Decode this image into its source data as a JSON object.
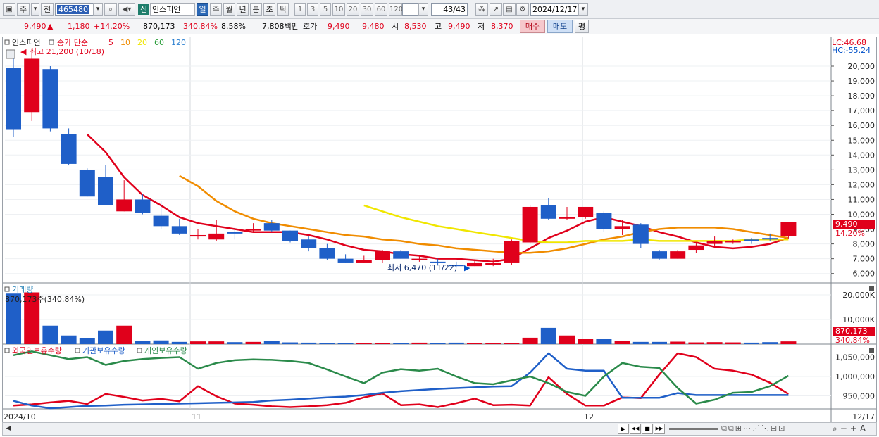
{
  "toolbar": {
    "market_label": "주",
    "prev_label": "전",
    "code": "465480",
    "name_tag": "신",
    "stock_name": "인스피언",
    "periods": [
      "일",
      "주",
      "월",
      "년",
      "분",
      "초",
      "틱"
    ],
    "active_period": "일",
    "intervals": [
      "1",
      "3",
      "5",
      "10",
      "20",
      "30",
      "60",
      "120"
    ],
    "count": "43",
    "count_total": "/43",
    "date": "2024/12/17"
  },
  "quote": {
    "price": "9,490",
    "arrow": "▲",
    "change": "1,180",
    "change_pct": "+14.20%",
    "volume": "870,173",
    "vol_ratio": "340.84%",
    "turnover": "8.58%",
    "amount": "7,808백만",
    "hoga_label": "호가",
    "ask": "9,490",
    "bid": "9,480",
    "open_label": "시",
    "open": "8,530",
    "high_label": "고",
    "high": "9,490",
    "low_label": "저",
    "low": "8,370",
    "buy_label": "매수",
    "sell_label": "매도",
    "avg_label": "평"
  },
  "chart_data": {
    "type": "candlestick",
    "title": "인스피언",
    "ma_label": "종가 단순",
    "ma_periods": [
      "5",
      "10",
      "20",
      "60",
      "120"
    ],
    "ma_colors": [
      "#e0001b",
      "#f08c00",
      "#f0e600",
      "#2a9d3a",
      "#2a7fd0"
    ],
    "high_note": "최고 21,200 (10/18)",
    "low_note": "최저 6,470 (11/22)",
    "lc_label": "LC:46.68",
    "hc_label": "HC:-55.24",
    "price_ticks": [
      "20,000",
      "19,000",
      "18,000",
      "17,000",
      "16,000",
      "15,000",
      "14,000",
      "13,000",
      "12,000",
      "11,000",
      "10,000",
      "9,000",
      "8,000",
      "7,000",
      "6,000"
    ],
    "last_price": "9,490",
    "last_pct": "14.20%",
    "x_labels": [
      "2024/10",
      "11",
      "12",
      "12/17"
    ],
    "up_color": "#e0001b",
    "down_color": "#1f5fc8",
    "candles": [
      {
        "o": 19900,
        "h": 20500,
        "l": 15200,
        "c": 15700
      },
      {
        "o": 16900,
        "h": 21200,
        "l": 16300,
        "c": 20500
      },
      {
        "o": 19800,
        "h": 20000,
        "l": 15600,
        "c": 15800
      },
      {
        "o": 15400,
        "h": 15800,
        "l": 13300,
        "c": 13400
      },
      {
        "o": 13000,
        "h": 13100,
        "l": 11200,
        "c": 11200
      },
      {
        "o": 12500,
        "h": 13300,
        "l": 10600,
        "c": 10600
      },
      {
        "o": 10200,
        "h": 12300,
        "l": 10200,
        "c": 11000
      },
      {
        "o": 11000,
        "h": 11400,
        "l": 10000,
        "c": 10100
      },
      {
        "o": 9900,
        "h": 10900,
        "l": 9000,
        "c": 9200
      },
      {
        "o": 9200,
        "h": 9700,
        "l": 8600,
        "c": 8700
      },
      {
        "o": 8500,
        "h": 9000,
        "l": 8300,
        "c": 8600
      },
      {
        "o": 8300,
        "h": 9600,
        "l": 8200,
        "c": 8700
      },
      {
        "o": 8800,
        "h": 9100,
        "l": 8300,
        "c": 8700
      },
      {
        "o": 8900,
        "h": 9400,
        "l": 8800,
        "c": 9000
      },
      {
        "o": 9400,
        "h": 9600,
        "l": 8800,
        "c": 8900
      },
      {
        "o": 8900,
        "h": 8900,
        "l": 8100,
        "c": 8200
      },
      {
        "o": 8300,
        "h": 8500,
        "l": 7500,
        "c": 7700
      },
      {
        "o": 7700,
        "h": 8000,
        "l": 6900,
        "c": 7000
      },
      {
        "o": 7000,
        "h": 7300,
        "l": 6700,
        "c": 6700
      },
      {
        "o": 6700,
        "h": 7200,
        "l": 6700,
        "c": 6900
      },
      {
        "o": 6900,
        "h": 7600,
        "l": 6700,
        "c": 7500
      },
      {
        "o": 7500,
        "h": 7600,
        "l": 7000,
        "c": 7000
      },
      {
        "o": 7000,
        "h": 7200,
        "l": 6800,
        "c": 7000
      },
      {
        "o": 6800,
        "h": 7000,
        "l": 6600,
        "c": 6700
      },
      {
        "o": 6600,
        "h": 6800,
        "l": 6470,
        "c": 6500
      },
      {
        "o": 6500,
        "h": 6900,
        "l": 6500,
        "c": 6700
      },
      {
        "o": 6600,
        "h": 7000,
        "l": 6500,
        "c": 6700
      },
      {
        "o": 6700,
        "h": 8300,
        "l": 6600,
        "c": 8200
      },
      {
        "o": 8100,
        "h": 10600,
        "l": 8000,
        "c": 10500
      },
      {
        "o": 10600,
        "h": 11100,
        "l": 9600,
        "c": 9700
      },
      {
        "o": 9700,
        "h": 10500,
        "l": 9600,
        "c": 9800
      },
      {
        "o": 9800,
        "h": 10500,
        "l": 9700,
        "c": 10500
      },
      {
        "o": 10100,
        "h": 10200,
        "l": 8800,
        "c": 9000
      },
      {
        "o": 9000,
        "h": 9600,
        "l": 8600,
        "c": 9200
      },
      {
        "o": 9300,
        "h": 9400,
        "l": 7700,
        "c": 8000
      },
      {
        "o": 7500,
        "h": 7600,
        "l": 6900,
        "c": 7000
      },
      {
        "o": 7000,
        "h": 7600,
        "l": 7000,
        "c": 7500
      },
      {
        "o": 7600,
        "h": 8100,
        "l": 7400,
        "c": 7900
      },
      {
        "o": 8000,
        "h": 8500,
        "l": 7800,
        "c": 8200
      },
      {
        "o": 8100,
        "h": 8300,
        "l": 8000,
        "c": 8200
      },
      {
        "o": 8300,
        "h": 8400,
        "l": 8000,
        "c": 8200
      },
      {
        "o": 8400,
        "h": 8700,
        "l": 8200,
        "c": 8300
      },
      {
        "o": 8530,
        "h": 9490,
        "l": 8370,
        "c": 9490
      }
    ],
    "ma5": [
      null,
      null,
      null,
      null,
      15400,
      14200,
      12500,
      11300,
      10600,
      9800,
      9400,
      9200,
      9000,
      8800,
      8800,
      8800,
      8600,
      8300,
      7900,
      7600,
      7500,
      7300,
      7200,
      7000,
      7000,
      6900,
      6800,
      7000,
      7700,
      8400,
      8900,
      9500,
      9800,
      9500,
      9200,
      8800,
      8500,
      8100,
      7800,
      7700,
      7800,
      8000,
      8400
    ],
    "ma10": [
      null,
      null,
      null,
      null,
      null,
      null,
      null,
      null,
      null,
      12600,
      11900,
      10900,
      10200,
      9700,
      9400,
      9200,
      9000,
      8800,
      8600,
      8500,
      8300,
      8200,
      8000,
      7900,
      7700,
      7600,
      7500,
      7400,
      7400,
      7500,
      7700,
      8000,
      8300,
      8500,
      8800,
      9000,
      9100,
      9100,
      9100,
      9000,
      8800,
      8600,
      8400
    ],
    "ma20": [
      null,
      null,
      null,
      null,
      null,
      null,
      null,
      null,
      null,
      null,
      null,
      null,
      null,
      null,
      null,
      null,
      null,
      null,
      null,
      10600,
      10200,
      9800,
      9500,
      9200,
      9000,
      8800,
      8600,
      8400,
      8200,
      8100,
      8100,
      8200,
      8200,
      8200,
      8300,
      8200,
      8200,
      8200,
      8200,
      8200,
      8300,
      8300,
      8300
    ],
    "volume_title": "거래량",
    "volume_note": "870,173주(340.84%)",
    "volume_ticks": [
      "20,000K",
      "10,000K"
    ],
    "volume_last": "870,173",
    "volume_last_pct": "340.84%",
    "volume": [
      20500,
      21000,
      7500,
      3500,
      2500,
      5500,
      7500,
      1200,
      1500,
      900,
      1100,
      1100,
      800,
      900,
      1300,
      700,
      600,
      500,
      500,
      500,
      500,
      500,
      600,
      500,
      600,
      500,
      500,
      500,
      2600,
      6600,
      3500,
      2000,
      2000,
      1300,
      900,
      900,
      1000,
      700,
      800,
      700,
      600,
      800,
      1100
    ],
    "holdings_titles": [
      "외국인보유수량",
      "기관보유수량",
      "개인보유수량"
    ],
    "holdings_colors": [
      "#e0001b",
      "#1f5fc8",
      "#2a8a4a"
    ],
    "holdings_ticks": [
      "1,050,000",
      "1,000,000",
      "950,000"
    ],
    "foreign": [
      925,
      928,
      933,
      937,
      929,
      955,
      947,
      938,
      942,
      936,
      975,
      949,
      930,
      927,
      923,
      921,
      923,
      926,
      932,
      946,
      956,
      926,
      928,
      921,
      931,
      943,
      926,
      927,
      925,
      998,
      955,
      925,
      925,
      946,
      944,
      1005,
      1060,
      1050,
      1020,
      1015,
      1005,
      984,
      955
    ],
    "institution": [
      937,
      925,
      918,
      921,
      924,
      925,
      927,
      928,
      929,
      930,
      931,
      932,
      933,
      934,
      938,
      940,
      943,
      946,
      948,
      952,
      958,
      962,
      965,
      968,
      970,
      972,
      974,
      975,
      1010,
      1060,
      1020,
      1015,
      1015,
      945,
      945,
      945,
      957,
      952,
      952,
      952,
      952,
      952,
      952
    ],
    "individual": [
      1055,
      1065,
      1055,
      1045,
      1050,
      1030,
      1040,
      1045,
      1048,
      1050,
      1020,
      1035,
      1042,
      1044,
      1043,
      1040,
      1035,
      1018,
      1000,
      983,
      1010,
      1019,
      1015,
      1020,
      1000,
      983,
      980,
      990,
      1000,
      983,
      960,
      950,
      1000,
      1035,
      1025,
      1022,
      970,
      930,
      940,
      958,
      960,
      975,
      1002
    ]
  },
  "bottom": {
    "nav_buttons": [
      "▶",
      "◀◀",
      "■",
      "▶▶"
    ]
  }
}
